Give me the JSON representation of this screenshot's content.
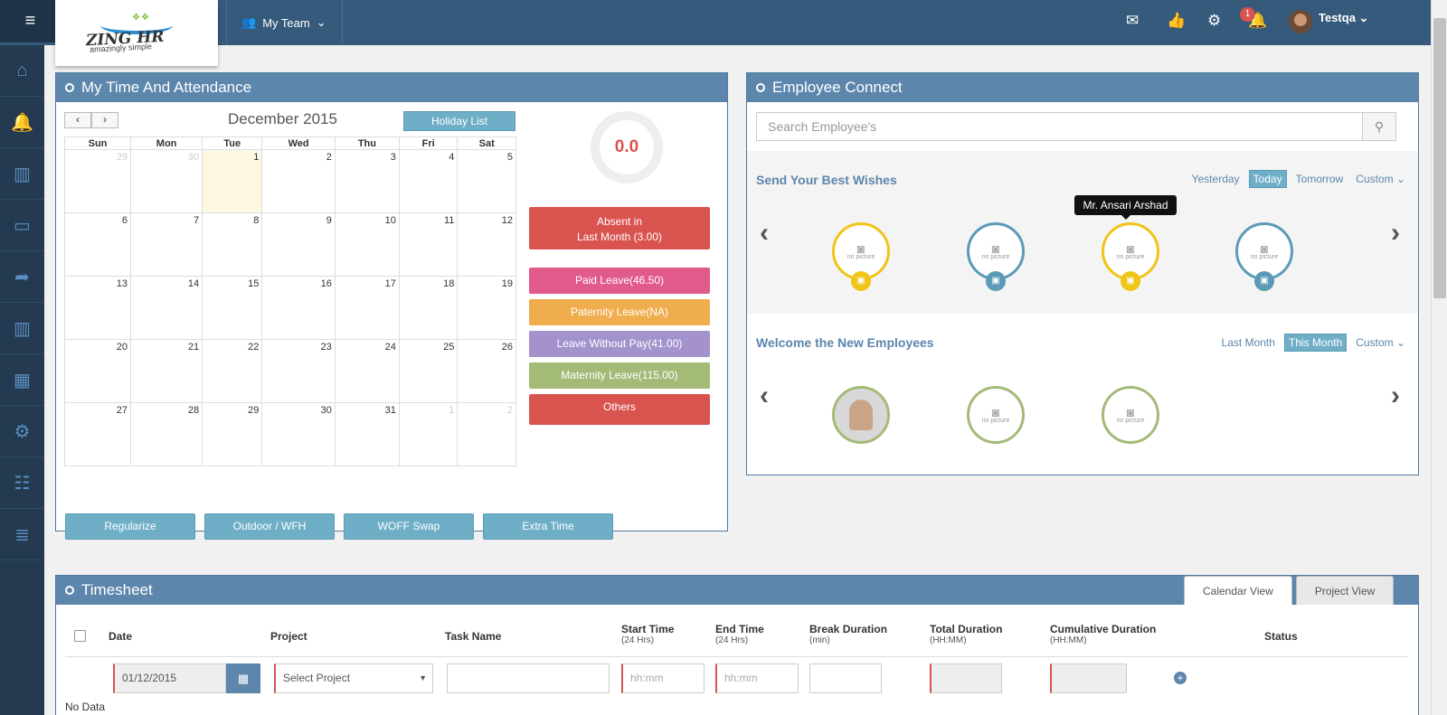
{
  "header": {
    "hamburger": "≡",
    "logo_name": "ZING HR",
    "logo_tag": "amazingly simple",
    "my_team": "My Team",
    "notif_count": "1",
    "user": "Testqa"
  },
  "sidebar": {
    "items": [
      "home-icon",
      "bell-icon",
      "chart-icon",
      "monitor-icon",
      "share-icon",
      "report-icon",
      "calendar-icon",
      "gears-icon",
      "sitemap-icon",
      "server-icon"
    ]
  },
  "attendance": {
    "title": "My Time And Attendance",
    "month": "December 2015",
    "holiday_btn": "Holiday List",
    "days": [
      "Sun",
      "Mon",
      "Tue",
      "Wed",
      "Thu",
      "Fri",
      "Sat"
    ],
    "weeks": [
      [
        "29",
        "30",
        "1",
        "2",
        "3",
        "4",
        "5"
      ],
      [
        "6",
        "7",
        "8",
        "9",
        "10",
        "11",
        "12"
      ],
      [
        "13",
        "14",
        "15",
        "16",
        "17",
        "18",
        "19"
      ],
      [
        "20",
        "21",
        "22",
        "23",
        "24",
        "25",
        "26"
      ],
      [
        "27",
        "28",
        "29",
        "30",
        "31",
        "1",
        "2"
      ]
    ],
    "donut_value": "0.0",
    "absent_line1": "Absent in",
    "absent_line2": "Last Month (3.00)",
    "leaves": [
      "Paid Leave(46.50)",
      "Paternity Leave(NA)",
      "Leave Without Pay(41.00)",
      "Maternity Leave(115.00)",
      "Others"
    ],
    "actions": [
      "Regularize",
      "Outdoor / WFH",
      "WOFF Swap",
      "Extra Time"
    ]
  },
  "connect": {
    "title": "Employee Connect",
    "search_placeholder": "Search Employee's",
    "wishes_title": "Send Your Best Wishes",
    "wishes_filters": [
      "Yesterday",
      "Today",
      "Tomorrow",
      "Custom ⌄"
    ],
    "tooltip": "Mr. Ansari Arshad",
    "no_picture": "no picture",
    "new_title": "Welcome the New Employees",
    "new_filters": [
      "Last Month",
      "This Month",
      "Custom ⌄"
    ]
  },
  "timesheet": {
    "title": "Timesheet",
    "tabs": [
      "Calendar View",
      "Project View"
    ],
    "col_date": "Date",
    "col_project": "Project",
    "col_task": "Task Name",
    "col_start": "Start Time",
    "col_start_sub": "(24 Hrs)",
    "col_end": "End Time",
    "col_end_sub": "(24 Hrs)",
    "col_break": "Break Duration",
    "col_break_sub": "(min)",
    "col_total": "Total Duration",
    "col_total_sub": "(HH:MM)",
    "col_cum": "Cumulative Duration",
    "col_cum_sub": "(HH:MM)",
    "col_status": "Status",
    "date_value": "01/12/2015",
    "project_value": "Select Project",
    "time_placeholder": "hh:mm",
    "no_data": "No Data"
  }
}
